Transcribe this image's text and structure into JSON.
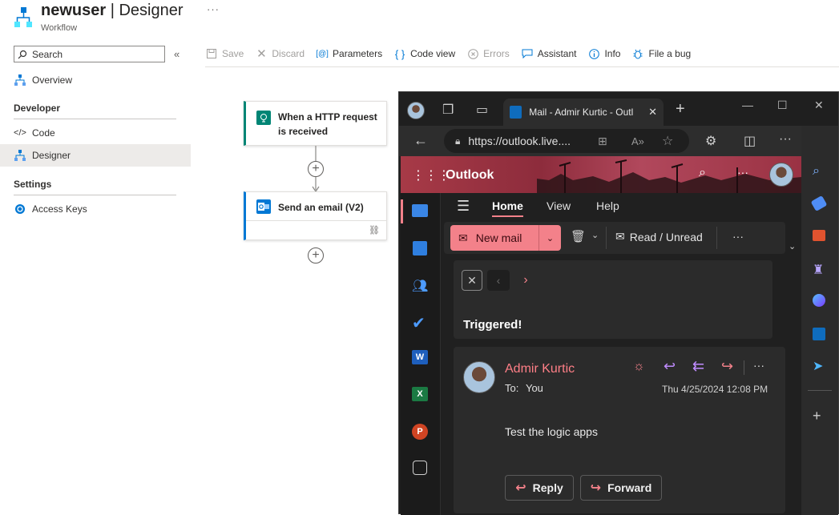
{
  "header": {
    "title_bold": "newuser",
    "title_rest": " | Designer",
    "subtitle": "Workflow",
    "more": "···"
  },
  "sidebar": {
    "search_label": "Search",
    "collapse": "«",
    "items": [
      {
        "label": "Overview"
      },
      {
        "label": "Code"
      },
      {
        "label": "Designer"
      },
      {
        "label": "Access Keys"
      }
    ],
    "sections": [
      "Developer",
      "Settings"
    ]
  },
  "toolbar": {
    "save": "Save",
    "discard": "Discard",
    "parameters": "Parameters",
    "code_view": "Code view",
    "errors": "Errors",
    "assistant": "Assistant",
    "info": "Info",
    "file_bug": "File a bug"
  },
  "workflow": {
    "trigger_line1": "When a HTTP request",
    "trigger_line2": "is received",
    "action_label": "Send an email (V2)"
  },
  "browser": {
    "tab_title": "Mail - Admir Kurtic - Outl",
    "address": "https://outlook.live....",
    "app_name": "Outlook"
  },
  "outlook": {
    "ribbon_tabs": [
      "Home",
      "View",
      "Help"
    ],
    "new_mail": "New mail",
    "read_unread": "Read / Unread",
    "subject": "Triggered!",
    "sender": "Admir Kurtic",
    "to_label": "To:",
    "to_value": "You",
    "date": "Thu 4/25/2024 12:08 PM",
    "body": "Test the logic apps",
    "reply": "Reply",
    "forward": "Forward"
  },
  "colors": {
    "azure_blue": "#0078d4",
    "outlook_pink": "#f3818a",
    "sender_color": "#ff7f87",
    "trigger_teal": "#008575"
  }
}
